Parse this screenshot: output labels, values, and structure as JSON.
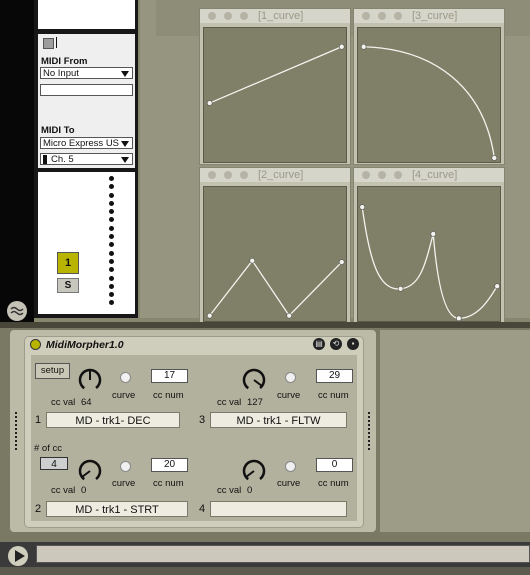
{
  "track": {
    "midi_from_label": "MIDI From",
    "midi_from_value": "No Input",
    "midi_to_label": "MIDI To",
    "midi_to_value": "Micro Express US",
    "midi_to_channel": "Ch. 5",
    "track_number": "1",
    "solo_label": "S"
  },
  "curve_windows": [
    {
      "title": "[1_curve]",
      "points": [
        [
          0.04,
          0.56
        ],
        [
          0.97,
          0.14
        ]
      ]
    },
    {
      "title": "[3_curve]",
      "points": [
        [
          0.04,
          0.14
        ],
        [
          0.96,
          0.97
        ]
      ]
    },
    {
      "title": "[2_curve]",
      "points": [
        [
          0.04,
          0.96
        ],
        [
          0.34,
          0.55
        ],
        [
          0.6,
          0.96
        ],
        [
          0.97,
          0.56
        ]
      ]
    },
    {
      "title": "[4_curve]",
      "points": [
        [
          0.03,
          0.15
        ],
        [
          0.3,
          0.76
        ],
        [
          0.53,
          0.35
        ],
        [
          0.71,
          0.98
        ],
        [
          0.98,
          0.74
        ]
      ]
    }
  ],
  "device": {
    "title": "MidiMorpher1.0",
    "setup_label": "setup",
    "num_cc_label": "# of cc",
    "num_cc_value": "4",
    "cc_val_label": "cc val",
    "curve_label": "curve",
    "cc_num_label": "cc num",
    "slots": [
      {
        "index": "1",
        "cc_val": "64",
        "cc_num": "17",
        "name": "MD - trk1- DEC"
      },
      {
        "index": "3",
        "cc_val": "127",
        "cc_num": "29",
        "name": "MD - trk1 - FLTW"
      },
      {
        "index": "2",
        "cc_val": "0",
        "cc_num": "20",
        "name": "MD - trk1 - STRT"
      },
      {
        "index": "4",
        "cc_val": "0",
        "cc_num": "0",
        "name": ""
      }
    ]
  }
}
